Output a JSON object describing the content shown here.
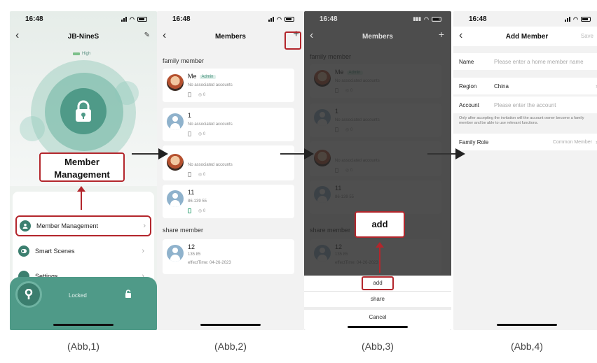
{
  "status_time": "16:48",
  "screen1": {
    "title": "JB-NineS",
    "battery_label": "High",
    "callout": "Member Management",
    "menu": [
      {
        "label": "Member Management"
      },
      {
        "label": "Smart Scenes"
      },
      {
        "label": "Settings"
      }
    ],
    "lock_status": "Locked",
    "caption": "(Abb,1)"
  },
  "screen2": {
    "title": "Members",
    "add_icon": "+",
    "family_section": "family member",
    "share_section": "share member",
    "family_members": [
      {
        "name": "Me",
        "badge": "Admin",
        "sub": "No associated accounts",
        "count": "0"
      },
      {
        "name": "1",
        "sub": "No associated accounts",
        "count": "0"
      },
      {
        "name": "",
        "sub": "No associated accounts",
        "count": "0"
      },
      {
        "name": "11",
        "sub": "86-139          55",
        "count": "0"
      }
    ],
    "share_members": [
      {
        "name": "12",
        "sub": "135          85",
        "effect": "effectTime: 04-26-2023"
      }
    ],
    "caption": "(Abb,2)"
  },
  "screen3": {
    "title": "Members",
    "callout": "add",
    "sheet": {
      "add": "add",
      "share": "share",
      "cancel": "Cancel"
    },
    "caption": "(Abb,3)"
  },
  "screen4": {
    "title": "Add Member",
    "save": "Save",
    "name_label": "Name",
    "name_placeholder": "Please enter a home member name",
    "region_label": "Region",
    "region_value": "China",
    "account_label": "Account",
    "account_placeholder": "Please enter the account",
    "note": "Only after accepting the invitation will the account owner become a family member and be able to use relevant functions.",
    "role_label": "Family Role",
    "role_value": "Common Member",
    "caption": "(Abb,4)"
  },
  "colors": {
    "accent": "#4f9a88",
    "highlight": "#b3262c"
  }
}
